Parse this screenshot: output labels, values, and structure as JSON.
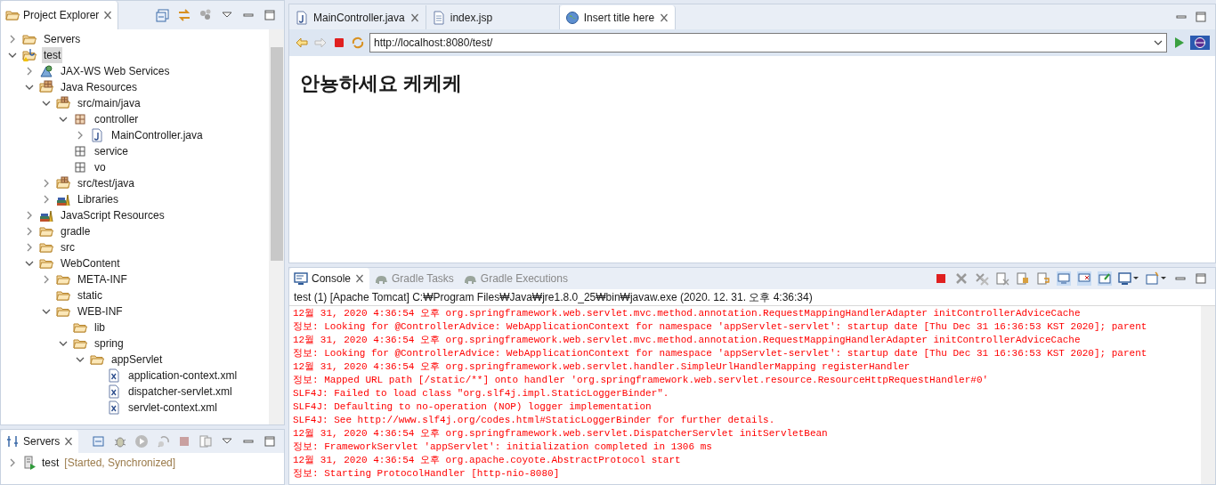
{
  "project_explorer": {
    "title": "Project Explorer",
    "tree": [
      {
        "label": "Servers",
        "kind": "folder_open",
        "expandable": true,
        "expanded": false,
        "selected": false
      },
      {
        "label": "test",
        "kind": "project",
        "expandable": true,
        "expanded": true,
        "selected": true,
        "children": [
          {
            "label": "JAX-WS Web Services",
            "kind": "webservices",
            "expandable": true,
            "expanded": false,
            "selected": false
          },
          {
            "label": "Java Resources",
            "kind": "java_resources",
            "expandable": true,
            "expanded": true,
            "selected": false,
            "children": [
              {
                "label": "src/main/java",
                "kind": "source_folder",
                "expandable": true,
                "expanded": true,
                "selected": false,
                "children": [
                  {
                    "label": "controller",
                    "kind": "package",
                    "expandable": true,
                    "expanded": true,
                    "selected": false,
                    "children": [
                      {
                        "label": "MainController.java",
                        "kind": "java_file",
                        "expandable": true,
                        "expanded": false,
                        "selected": false
                      }
                    ]
                  },
                  {
                    "label": "service",
                    "kind": "empty_package",
                    "expandable": false,
                    "expanded": false,
                    "selected": false
                  },
                  {
                    "label": "vo",
                    "kind": "empty_package",
                    "expandable": false,
                    "expanded": false,
                    "selected": false
                  }
                ]
              },
              {
                "label": "src/test/java",
                "kind": "source_folder",
                "expandable": true,
                "expanded": false,
                "selected": false
              },
              {
                "label": "Libraries",
                "kind": "library",
                "expandable": true,
                "expanded": false,
                "selected": false
              }
            ]
          },
          {
            "label": "JavaScript Resources",
            "kind": "library",
            "expandable": true,
            "expanded": false,
            "selected": false
          },
          {
            "label": "gradle",
            "kind": "folder",
            "expandable": true,
            "expanded": false,
            "selected": false
          },
          {
            "label": "src",
            "kind": "folder",
            "expandable": true,
            "expanded": false,
            "selected": false
          },
          {
            "label": "WebContent",
            "kind": "folder",
            "expandable": true,
            "expanded": true,
            "selected": false,
            "children": [
              {
                "label": "META-INF",
                "kind": "folder",
                "expandable": true,
                "expanded": false,
                "selected": false
              },
              {
                "label": "static",
                "kind": "folder",
                "expandable": false,
                "expanded": false,
                "selected": false
              },
              {
                "label": "WEB-INF",
                "kind": "folder",
                "expandable": true,
                "expanded": true,
                "selected": false,
                "children": [
                  {
                    "label": "lib",
                    "kind": "folder",
                    "expandable": false,
                    "expanded": false,
                    "selected": false
                  },
                  {
                    "label": "spring",
                    "kind": "folder",
                    "expandable": true,
                    "expanded": true,
                    "selected": false,
                    "children": [
                      {
                        "label": "appServlet",
                        "kind": "folder",
                        "expandable": true,
                        "expanded": true,
                        "selected": false,
                        "children": [
                          {
                            "label": "application-context.xml",
                            "kind": "xml",
                            "expandable": false,
                            "expanded": false,
                            "selected": false
                          },
                          {
                            "label": "dispatcher-servlet.xml",
                            "kind": "xml",
                            "expandable": false,
                            "expanded": false,
                            "selected": false
                          },
                          {
                            "label": "servlet-context.xml",
                            "kind": "xml",
                            "expandable": false,
                            "expanded": false,
                            "selected": false
                          }
                        ]
                      }
                    ]
                  }
                ]
              }
            ]
          }
        ]
      }
    ]
  },
  "servers_view": {
    "title": "Servers",
    "items": [
      {
        "name": "test",
        "status": "[Started, Synchronized]",
        "expanded": false
      }
    ]
  },
  "editor_tabs": [
    {
      "label": "MainController.java",
      "kind": "java",
      "selected": false,
      "closable": true
    },
    {
      "label": "index.jsp",
      "kind": "jsp",
      "selected": false,
      "closable": false
    },
    {
      "label": "Insert title here",
      "kind": "browser",
      "selected": true,
      "closable": true
    }
  ],
  "browser": {
    "url": "http://localhost:8080/test/",
    "heading": "안뇽하세요 케케케"
  },
  "console_tabs": [
    {
      "label": "Console",
      "kind": "console",
      "selected": true
    },
    {
      "label": "Gradle Tasks",
      "kind": "gradle",
      "selected": false
    },
    {
      "label": "Gradle Executions",
      "kind": "gradle",
      "selected": false
    }
  ],
  "console": {
    "process": "test (1) [Apache Tomcat] C:₩Program Files₩Java₩jre1.8.0_25₩bin₩javaw.exe (2020. 12. 31. 오후 4:36:34)",
    "lines": [
      "12월 31, 2020 4:36:54 오후 org.springframework.web.servlet.mvc.method.annotation.RequestMappingHandlerAdapter initControllerAdviceCache",
      "정보: Looking for @ControllerAdvice: WebApplicationContext for namespace 'appServlet-servlet': startup date [Thu Dec 31 16:36:53 KST 2020]; parent",
      "12월 31, 2020 4:36:54 오후 org.springframework.web.servlet.mvc.method.annotation.RequestMappingHandlerAdapter initControllerAdviceCache",
      "정보: Looking for @ControllerAdvice: WebApplicationContext for namespace 'appServlet-servlet': startup date [Thu Dec 31 16:36:53 KST 2020]; parent",
      "12월 31, 2020 4:36:54 오후 org.springframework.web.servlet.handler.SimpleUrlHandlerMapping registerHandler",
      "정보: Mapped URL path [/static/**] onto handler 'org.springframework.web.servlet.resource.ResourceHttpRequestHandler#0'",
      "SLF4J: Failed to load class \"org.slf4j.impl.StaticLoggerBinder\".",
      "SLF4J: Defaulting to no-operation (NOP) logger implementation",
      "SLF4J: See http://www.slf4j.org/codes.html#StaticLoggerBinder for further details.",
      "12월 31, 2020 4:36:54 오후 org.springframework.web.servlet.DispatcherServlet initServletBean",
      "정보: FrameworkServlet 'appServlet': initialization completed in 1306 ms",
      "12월 31, 2020 4:36:54 오후 org.apache.coyote.AbstractProtocol start",
      "정보: Starting ProtocolHandler [http-nio-8080]"
    ]
  }
}
